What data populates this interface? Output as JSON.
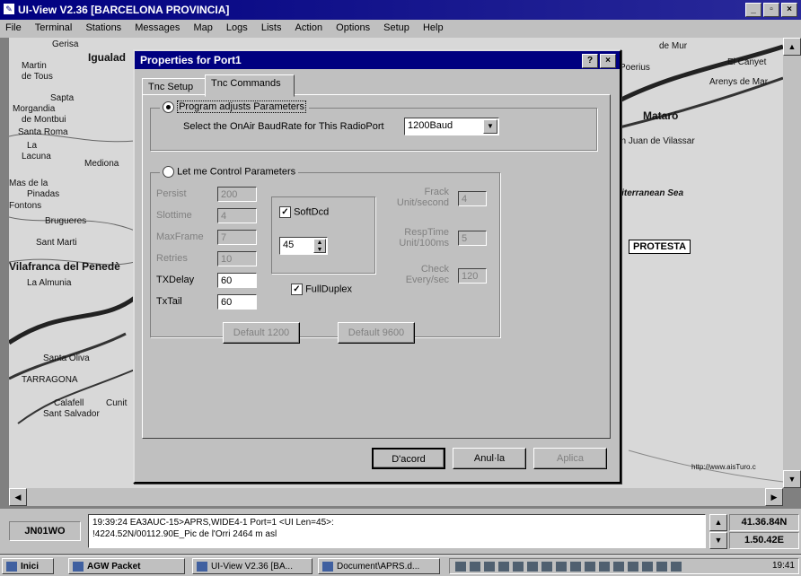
{
  "window": {
    "title": "UI-View V2.36 [BARCELONA PROVINCIA]",
    "buttons": [
      "_",
      "▫",
      "×"
    ]
  },
  "menu": [
    "File",
    "Terminal",
    "Stations",
    "Messages",
    "Map",
    "Logs",
    "Lists",
    "Action",
    "Options",
    "Setup",
    "Help"
  ],
  "map": {
    "labels": [
      "Igualad",
      "Gerisa",
      "Martin",
      "de Tous",
      "Sapta",
      "Morgandia",
      "de Montbui",
      "Santa Roma",
      "La",
      "Lacuna",
      "Mediona",
      "Mas de la",
      "Pinadas",
      "Fontons",
      "Brugueres",
      "Sant Marti",
      "Vilafranca del Penedè",
      "La Almunia",
      "Santa Oliva",
      "TARRAGONA",
      "Calafell",
      "Cunit",
      "Sant Salvador",
      "Poerius",
      "El Canyet",
      "Arenys de Mar",
      "Mataró",
      "an Juan de Vilassar",
      "diterranean Sea",
      "de Mur",
      "http://www.aisTuro.c"
    ],
    "marker": "PROTESTA"
  },
  "dialog": {
    "title": "Properties for Port1",
    "title_buttons": [
      "?",
      "×"
    ],
    "tabs": [
      "Tnc Setup",
      "Tnc Commands"
    ],
    "group1": {
      "radio_label": "Program adjusts Parameters",
      "baud_prompt": "Select the OnAir BaudRate for This RadioPort",
      "baud_value": "1200Baud"
    },
    "group2": {
      "radio_label": "Let me Control Parameters",
      "params": [
        {
          "label": "Persist",
          "value": "200"
        },
        {
          "label": "Slottime",
          "value": "4"
        },
        {
          "label": "MaxFrame",
          "value": "7"
        },
        {
          "label": "Retries",
          "value": "10"
        },
        {
          "label": "TXDelay",
          "value": "60"
        },
        {
          "label": "TxTail",
          "value": "60"
        }
      ],
      "softdcd_label": "SoftDcd",
      "softdcd_value": "45",
      "fullduplex_label": "FullDuplex",
      "right_params": [
        {
          "label": "Frack Unit/second",
          "value": "4"
        },
        {
          "label": "RespTime Unit/100ms",
          "value": "5"
        },
        {
          "label": "Check Every/sec",
          "value": "120"
        }
      ],
      "default1": "Default 1200",
      "default2": "Default 9600"
    },
    "ok": "D'acord",
    "cancel": "Anul·la",
    "apply": "Aplica"
  },
  "status": {
    "callsign": "JN01WO",
    "line1": "19:39:24 EA3AUC-15>APRS,WIDE4-1 Port=1 <UI Len=45>:",
    "line2": "!4224.52N/00112.90E_Pic de l'Orri 2464 m asl",
    "lat": "41.36.84N",
    "lon": "1.50.42E"
  },
  "taskbar": {
    "start": "Inici",
    "tasks": [
      "AGW Packet",
      "UI-View V2.36 [BA...",
      "Document\\APRS.d..."
    ],
    "clock": "19:41"
  }
}
